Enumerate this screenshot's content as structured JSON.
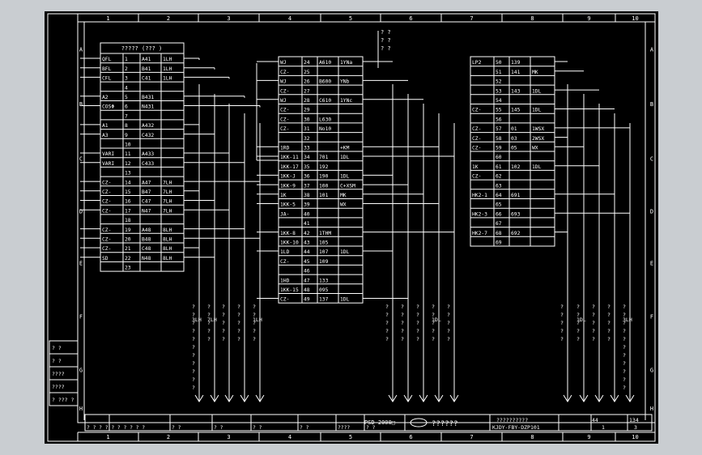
{
  "frame": {
    "top_numbers": [
      "1",
      "2",
      "3",
      "4",
      "5",
      "6",
      "7",
      "8",
      "9",
      "10"
    ],
    "bottom_numbers": [
      "1",
      "2",
      "3",
      "4",
      "5",
      "6",
      "7",
      "8",
      "9",
      "10"
    ],
    "side_letters": [
      "A",
      "B",
      "C",
      "D",
      "E",
      "F",
      "G",
      "H"
    ]
  },
  "table_left": {
    "header": "????? (??? )",
    "rows": [
      [
        "QFL",
        "1",
        "A41",
        "1LH"
      ],
      [
        "BFL",
        "2",
        "B41",
        "1LH"
      ],
      [
        "CFL",
        "3",
        "C41",
        "1LH"
      ],
      [
        "",
        "4",
        "",
        ""
      ],
      [
        "A2",
        "5",
        "B431",
        ""
      ],
      [
        "COSΦ",
        "6",
        "N431",
        ""
      ],
      [
        "",
        "7",
        "",
        ""
      ],
      [
        "A1",
        "8",
        "A432",
        ""
      ],
      [
        "A3",
        "9",
        "C432",
        ""
      ],
      [
        "",
        "10",
        "",
        ""
      ],
      [
        "VARI",
        "11",
        "A433",
        ""
      ],
      [
        "VARI",
        "12",
        "C433",
        ""
      ],
      [
        "",
        "13",
        "",
        ""
      ],
      [
        "CZ-",
        "14",
        "A47",
        "7LH"
      ],
      [
        "CZ-",
        "15",
        "B47",
        "7LH"
      ],
      [
        "CZ-",
        "16",
        "C47",
        "7LH"
      ],
      [
        "CZ-",
        "17",
        "N47",
        "7LH"
      ],
      [
        "",
        "18",
        "",
        ""
      ],
      [
        "CZ-",
        "19",
        "A48",
        "8LH"
      ],
      [
        "CZ-",
        "20",
        "B48",
        "8LH"
      ],
      [
        "CZ-",
        "21",
        "C48",
        "8LH"
      ],
      [
        "SD",
        "22",
        "N48",
        "8LH"
      ],
      [
        "",
        "23",
        "",
        ""
      ]
    ]
  },
  "table_middle": {
    "rows": [
      [
        "WJ",
        "24",
        "A610",
        "1YNa"
      ],
      [
        "CZ-",
        "25",
        "",
        ""
      ],
      [
        "WJ",
        "26",
        "B600",
        "YNb"
      ],
      [
        "CZ-",
        "27",
        "",
        ""
      ],
      [
        "WJ",
        "28",
        "C610",
        "1YNc"
      ],
      [
        "CZ-",
        "29",
        "",
        ""
      ],
      [
        "CZ-",
        "30",
        "L630",
        ""
      ],
      [
        "CZ-",
        "31",
        "No10",
        ""
      ],
      [
        "",
        "32",
        "",
        ""
      ],
      [
        "1RD",
        "33",
        "",
        "+KM"
      ],
      [
        "1KK-11",
        "34",
        "701",
        "1DL"
      ],
      [
        "1KK-17",
        "35",
        "192",
        ""
      ],
      [
        "1KK-J",
        "36",
        "190",
        "1DL"
      ],
      [
        "1KK-9",
        "37",
        "100",
        "C+XSM"
      ],
      [
        "1K",
        "38",
        "101",
        "MK"
      ],
      [
        "1KK-5",
        "39",
        "",
        "WX"
      ],
      [
        "JA-",
        "40",
        "",
        ""
      ],
      [
        "",
        "41",
        "",
        ""
      ],
      [
        "1KK-8",
        "42",
        "1THM",
        ""
      ],
      [
        "1KK-10",
        "43",
        "105",
        ""
      ],
      [
        "1LD",
        "44",
        "107",
        "1DL"
      ],
      [
        "CZ-",
        "45",
        "109",
        ""
      ],
      [
        "",
        "46",
        "",
        ""
      ],
      [
        "1HD",
        "47",
        "133",
        ""
      ],
      [
        "1KK-15",
        "48",
        "095",
        ""
      ],
      [
        "CZ-",
        "49",
        "137",
        "1DL"
      ]
    ]
  },
  "table_right": {
    "rows": [
      [
        "LP2",
        "50",
        "139",
        ""
      ],
      [
        "",
        "51",
        "141",
        "MK"
      ],
      [
        "",
        "52",
        "",
        ""
      ],
      [
        "",
        "53",
        "143",
        "1DL"
      ],
      [
        "",
        "54",
        "",
        ""
      ],
      [
        "CZ-",
        "55",
        "145",
        "1DL"
      ],
      [
        "",
        "56",
        "",
        ""
      ],
      [
        "CZ-",
        "57",
        "01",
        "1WSX"
      ],
      [
        "CZ-",
        "58",
        "03",
        "2WSX"
      ],
      [
        "CZ-",
        "59",
        "05",
        "WX"
      ],
      [
        "",
        "60",
        "",
        ""
      ],
      [
        "1K",
        "61",
        "102",
        "1DL"
      ],
      [
        "CZ-",
        "62",
        "",
        ""
      ],
      [
        "",
        "63",
        "",
        ""
      ],
      [
        "HK2-1",
        "64",
        "691",
        ""
      ],
      [
        "",
        "65",
        "",
        ""
      ],
      [
        "HK2-3",
        "66",
        "693",
        ""
      ],
      [
        "",
        "67",
        "",
        ""
      ],
      [
        "HK2-7",
        "68",
        "692",
        ""
      ],
      [
        "",
        "69",
        "",
        ""
      ]
    ]
  },
  "top_marks": [
    "? ?",
    "? ?",
    "? ?"
  ],
  "bus_groups": [
    {
      "labels": [
        "?",
        "?",
        "?",
        "?",
        "?",
        "?",
        "?",
        "?",
        "?",
        "?",
        "?"
      ],
      "tag": "3LH",
      "tag_rows": [
        1
      ]
    },
    {
      "labels": [
        "?",
        "?",
        "?",
        "?",
        "?"
      ],
      "tag": "7LH"
    },
    {
      "labels": [
        "?",
        "?",
        "?",
        "?",
        "?"
      ],
      "tag": ""
    },
    {
      "labels": [
        "?",
        "?",
        "?",
        "?",
        "?"
      ],
      "tag": ""
    },
    {
      "labels": [
        "?",
        "?",
        "?",
        "?",
        "?"
      ],
      "tag": "1LH"
    },
    {
      "labels": [
        "?",
        "?",
        "?",
        "?",
        "?"
      ],
      "tag": ""
    },
    {
      "labels": [
        "?",
        "?",
        "?",
        "?",
        "?"
      ],
      "tag": ""
    },
    {
      "labels": [
        "?",
        "?",
        "?",
        "?",
        "?"
      ],
      "tag": ""
    },
    {
      "labels": [
        "?",
        "?",
        "?",
        "?",
        "?"
      ],
      "tag": "1DL"
    },
    {
      "labels": [
        "?",
        "?",
        "?",
        "?",
        "?"
      ],
      "tag": ""
    },
    {
      "labels": [
        "?",
        "?",
        "?",
        "?",
        "?"
      ],
      "tag": ""
    },
    {
      "labels": [
        "?",
        "?",
        "?",
        "?",
        "?"
      ],
      "tag": "1DL"
    },
    {
      "labels": [
        "?",
        "?",
        "?",
        "?",
        "?"
      ],
      "tag": ""
    },
    {
      "labels": [
        "?",
        "?",
        "?",
        "?",
        "?"
      ],
      "tag": ""
    }
  ],
  "left_stamp": [
    "? ?",
    "? ?",
    "????",
    "????",
    "? ??? ?"
  ],
  "title_block": {
    "drawing_no": "PSD-2000□",
    "company": "??????",
    "code": "KJDY-FBY-DZP101",
    "title": "??????????",
    "page": "44",
    "total": "134",
    "sheet": "1",
    "sheets": "3",
    "cells": [
      "? ? ? ? ? ? ? ? ? ?",
      "? ?",
      "? ?",
      "? ?",
      "? ?",
      "????",
      "? ?"
    ]
  }
}
